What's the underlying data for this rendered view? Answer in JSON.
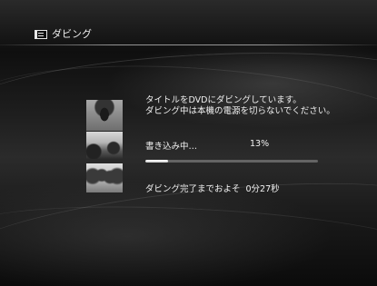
{
  "header": {
    "title": "ダビング",
    "icon": "film-icon"
  },
  "thumbnails": [
    {
      "name": "thumbnail-1"
    },
    {
      "name": "thumbnail-2"
    },
    {
      "name": "thumbnail-3"
    }
  ],
  "message": {
    "line1": "タイトルをDVDにダビングしています。",
    "line2": "ダビング中は本機の電源を切らないでください。"
  },
  "progress": {
    "status_label": "書き込み中…",
    "percent_text": "13%",
    "value": 0.13
  },
  "remaining": {
    "label": "ダビング完了までおよそ",
    "time": "0分27秒"
  }
}
